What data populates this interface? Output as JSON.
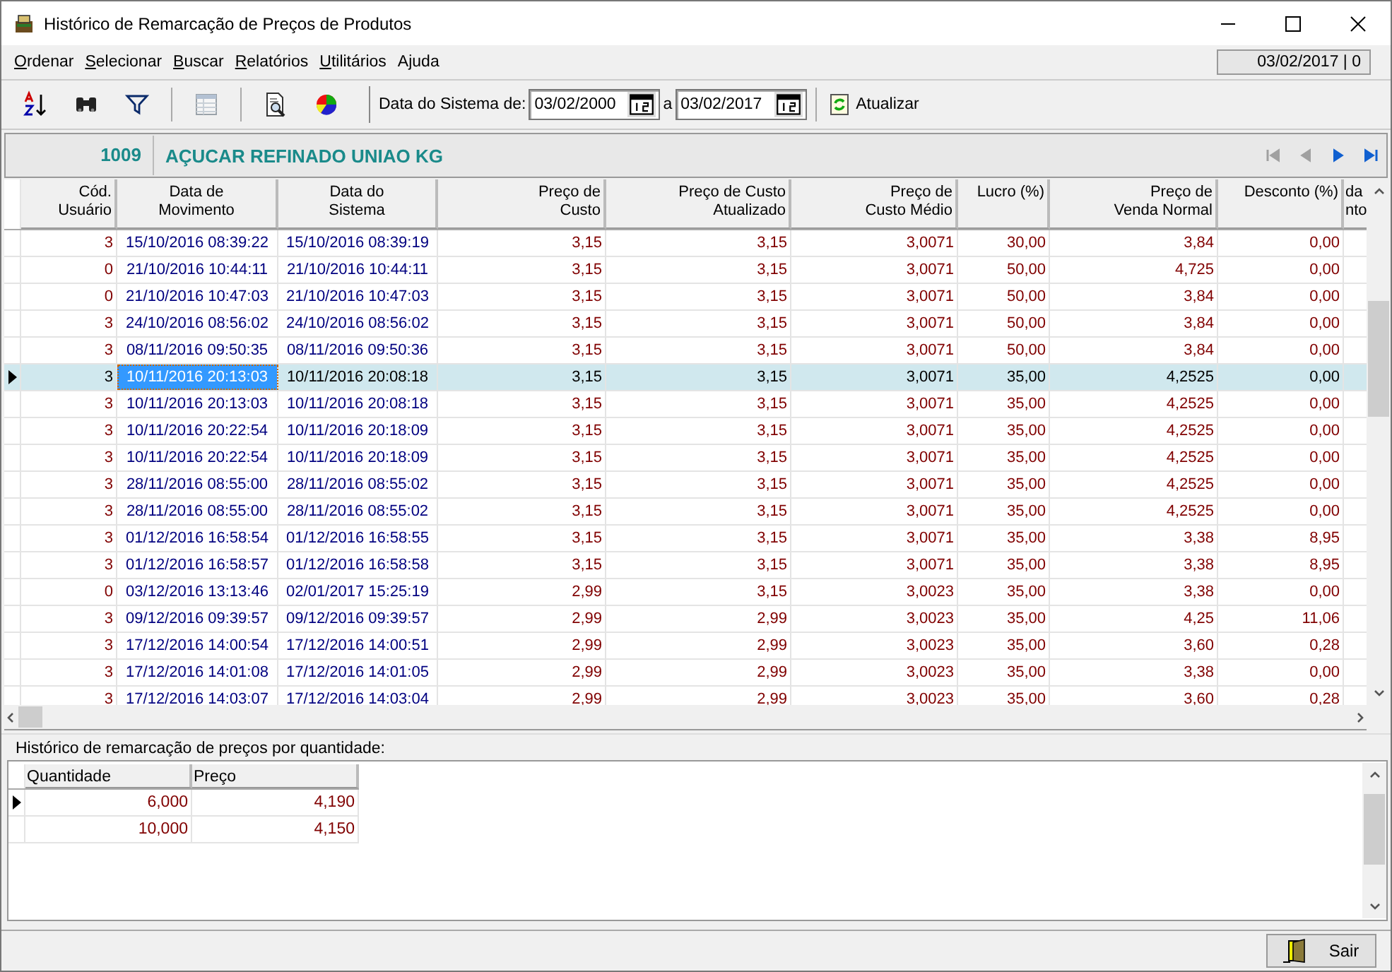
{
  "window": {
    "title": "Histórico de Remarcação de Preços de Produtos"
  },
  "menu": [
    {
      "label": "Ordenar",
      "accel": true
    },
    {
      "label": "Selecionar",
      "accel": true
    },
    {
      "label": "Buscar",
      "accel": true
    },
    {
      "label": "Relatórios",
      "accel": true
    },
    {
      "label": "Utilitários",
      "accel": true
    },
    {
      "label": "Ajuda",
      "accel": false
    }
  ],
  "status_box": "03/02/2017 | 0",
  "toolbar": {
    "tools": [
      {
        "kind": "sort",
        "disabled": false
      },
      {
        "kind": "find",
        "disabled": false
      },
      {
        "kind": "filter",
        "disabled": false
      },
      {
        "kind": "sep"
      },
      {
        "kind": "columns",
        "disabled": true
      },
      {
        "kind": "sep"
      },
      {
        "kind": "preview",
        "disabled": false
      },
      {
        "kind": "chart",
        "disabled": false
      }
    ],
    "date_label": "Data do Sistema de:",
    "date_from": "03/02/2000",
    "range_label": "a",
    "date_to": "03/02/2017",
    "refresh_label": "Atualizar"
  },
  "product": {
    "code": "1009",
    "name": "AÇUCAR REFINADO UNIAO KG"
  },
  "navigator": [
    {
      "kind": "first",
      "disabled": true
    },
    {
      "kind": "prev",
      "disabled": true
    },
    {
      "kind": "next",
      "disabled": false
    },
    {
      "kind": "last",
      "disabled": false
    }
  ],
  "table": {
    "columns": [
      {
        "label": "Cód. Usuário",
        "kind": "code",
        "focused": false
      },
      {
        "label": "Data de\nMovimento",
        "kind": "date",
        "focused": true
      },
      {
        "label": "Data do\nSistema",
        "kind": "date",
        "focused": false
      },
      {
        "label": "Preço de\nCusto",
        "kind": "number",
        "focused": false
      },
      {
        "label": "Preço de Custo\nAtualizado",
        "kind": "number",
        "focused": false
      },
      {
        "label": "Preço de\nCusto Médio",
        "kind": "number",
        "focused": false
      },
      {
        "label": "Lucro (%)",
        "kind": "number",
        "focused": false
      },
      {
        "label": "Preço de\nVenda Normal",
        "kind": "number",
        "focused": false
      },
      {
        "label": "Desconto (%)",
        "kind": "number",
        "focused": false
      },
      {
        "label": "da\nnto",
        "kind": "partial",
        "focused": false
      }
    ],
    "rows": [
      {
        "selected": false,
        "cells": [
          "3",
          "15/10/2016 08:39:22",
          "15/10/2016 08:39:19",
          "3,15",
          "3,15",
          "3,0071",
          "30,00",
          "3,84",
          "0,00"
        ]
      },
      {
        "selected": false,
        "cells": [
          "0",
          "21/10/2016 10:44:11",
          "21/10/2016 10:44:11",
          "3,15",
          "3,15",
          "3,0071",
          "50,00",
          "4,725",
          "0,00"
        ]
      },
      {
        "selected": false,
        "cells": [
          "0",
          "21/10/2016 10:47:03",
          "21/10/2016 10:47:03",
          "3,15",
          "3,15",
          "3,0071",
          "50,00",
          "3,84",
          "0,00"
        ]
      },
      {
        "selected": false,
        "cells": [
          "3",
          "24/10/2016 08:56:02",
          "24/10/2016 08:56:02",
          "3,15",
          "3,15",
          "3,0071",
          "50,00",
          "3,84",
          "0,00"
        ]
      },
      {
        "selected": false,
        "cells": [
          "3",
          "08/11/2016 09:50:35",
          "08/11/2016 09:50:36",
          "3,15",
          "3,15",
          "3,0071",
          "50,00",
          "3,84",
          "0,00"
        ]
      },
      {
        "selected": true,
        "cells": [
          "3",
          "10/11/2016 20:13:03",
          "10/11/2016 20:08:18",
          "3,15",
          "3,15",
          "3,0071",
          "35,00",
          "4,2525",
          "0,00"
        ]
      },
      {
        "selected": false,
        "cells": [
          "3",
          "10/11/2016 20:13:03",
          "10/11/2016 20:08:18",
          "3,15",
          "3,15",
          "3,0071",
          "35,00",
          "4,2525",
          "0,00"
        ]
      },
      {
        "selected": false,
        "cells": [
          "3",
          "10/11/2016 20:22:54",
          "10/11/2016 20:18:09",
          "3,15",
          "3,15",
          "3,0071",
          "35,00",
          "4,2525",
          "0,00"
        ]
      },
      {
        "selected": false,
        "cells": [
          "3",
          "10/11/2016 20:22:54",
          "10/11/2016 20:18:09",
          "3,15",
          "3,15",
          "3,0071",
          "35,00",
          "4,2525",
          "0,00"
        ]
      },
      {
        "selected": false,
        "cells": [
          "3",
          "28/11/2016 08:55:00",
          "28/11/2016 08:55:02",
          "3,15",
          "3,15",
          "3,0071",
          "35,00",
          "4,2525",
          "0,00"
        ]
      },
      {
        "selected": false,
        "cells": [
          "3",
          "28/11/2016 08:55:00",
          "28/11/2016 08:55:02",
          "3,15",
          "3,15",
          "3,0071",
          "35,00",
          "4,2525",
          "0,00"
        ]
      },
      {
        "selected": false,
        "cells": [
          "3",
          "01/12/2016 16:58:54",
          "01/12/2016 16:58:55",
          "3,15",
          "3,15",
          "3,0071",
          "35,00",
          "3,38",
          "8,95"
        ]
      },
      {
        "selected": false,
        "cells": [
          "3",
          "01/12/2016 16:58:57",
          "01/12/2016 16:58:58",
          "3,15",
          "3,15",
          "3,0071",
          "35,00",
          "3,38",
          "8,95"
        ]
      },
      {
        "selected": false,
        "cells": [
          "0",
          "03/12/2016 13:13:46",
          "02/01/2017 15:25:19",
          "2,99",
          "3,15",
          "3,0023",
          "35,00",
          "3,38",
          "0,00"
        ]
      },
      {
        "selected": false,
        "cells": [
          "3",
          "09/12/2016 09:39:57",
          "09/12/2016 09:39:57",
          "2,99",
          "2,99",
          "3,0023",
          "35,00",
          "4,25",
          "11,06"
        ]
      },
      {
        "selected": false,
        "cells": [
          "3",
          "17/12/2016 14:00:54",
          "17/12/2016 14:00:51",
          "2,99",
          "2,99",
          "3,0023",
          "35,00",
          "3,60",
          "0,28"
        ]
      },
      {
        "selected": false,
        "cells": [
          "3",
          "17/12/2016 14:01:08",
          "17/12/2016 14:01:05",
          "2,99",
          "2,99",
          "3,0023",
          "35,00",
          "3,38",
          "0,00"
        ]
      },
      {
        "selected": false,
        "cells": [
          "3",
          "17/12/2016 14:03:07",
          "17/12/2016 14:03:04",
          "2,99",
          "2,99",
          "3,0023",
          "35,00",
          "3,60",
          "0,28"
        ]
      }
    ]
  },
  "quantity_panel": {
    "title": "Histórico de remarcação de preços por quantidade:",
    "columns": [
      "Quantidade",
      "Preço"
    ],
    "rows": [
      {
        "selected": true,
        "cells": [
          "6,000",
          "4,190"
        ]
      },
      {
        "selected": false,
        "cells": [
          "10,000",
          "4,150"
        ]
      }
    ]
  },
  "buttons": [
    {
      "label": "Sair",
      "kind": "exit"
    }
  ]
}
